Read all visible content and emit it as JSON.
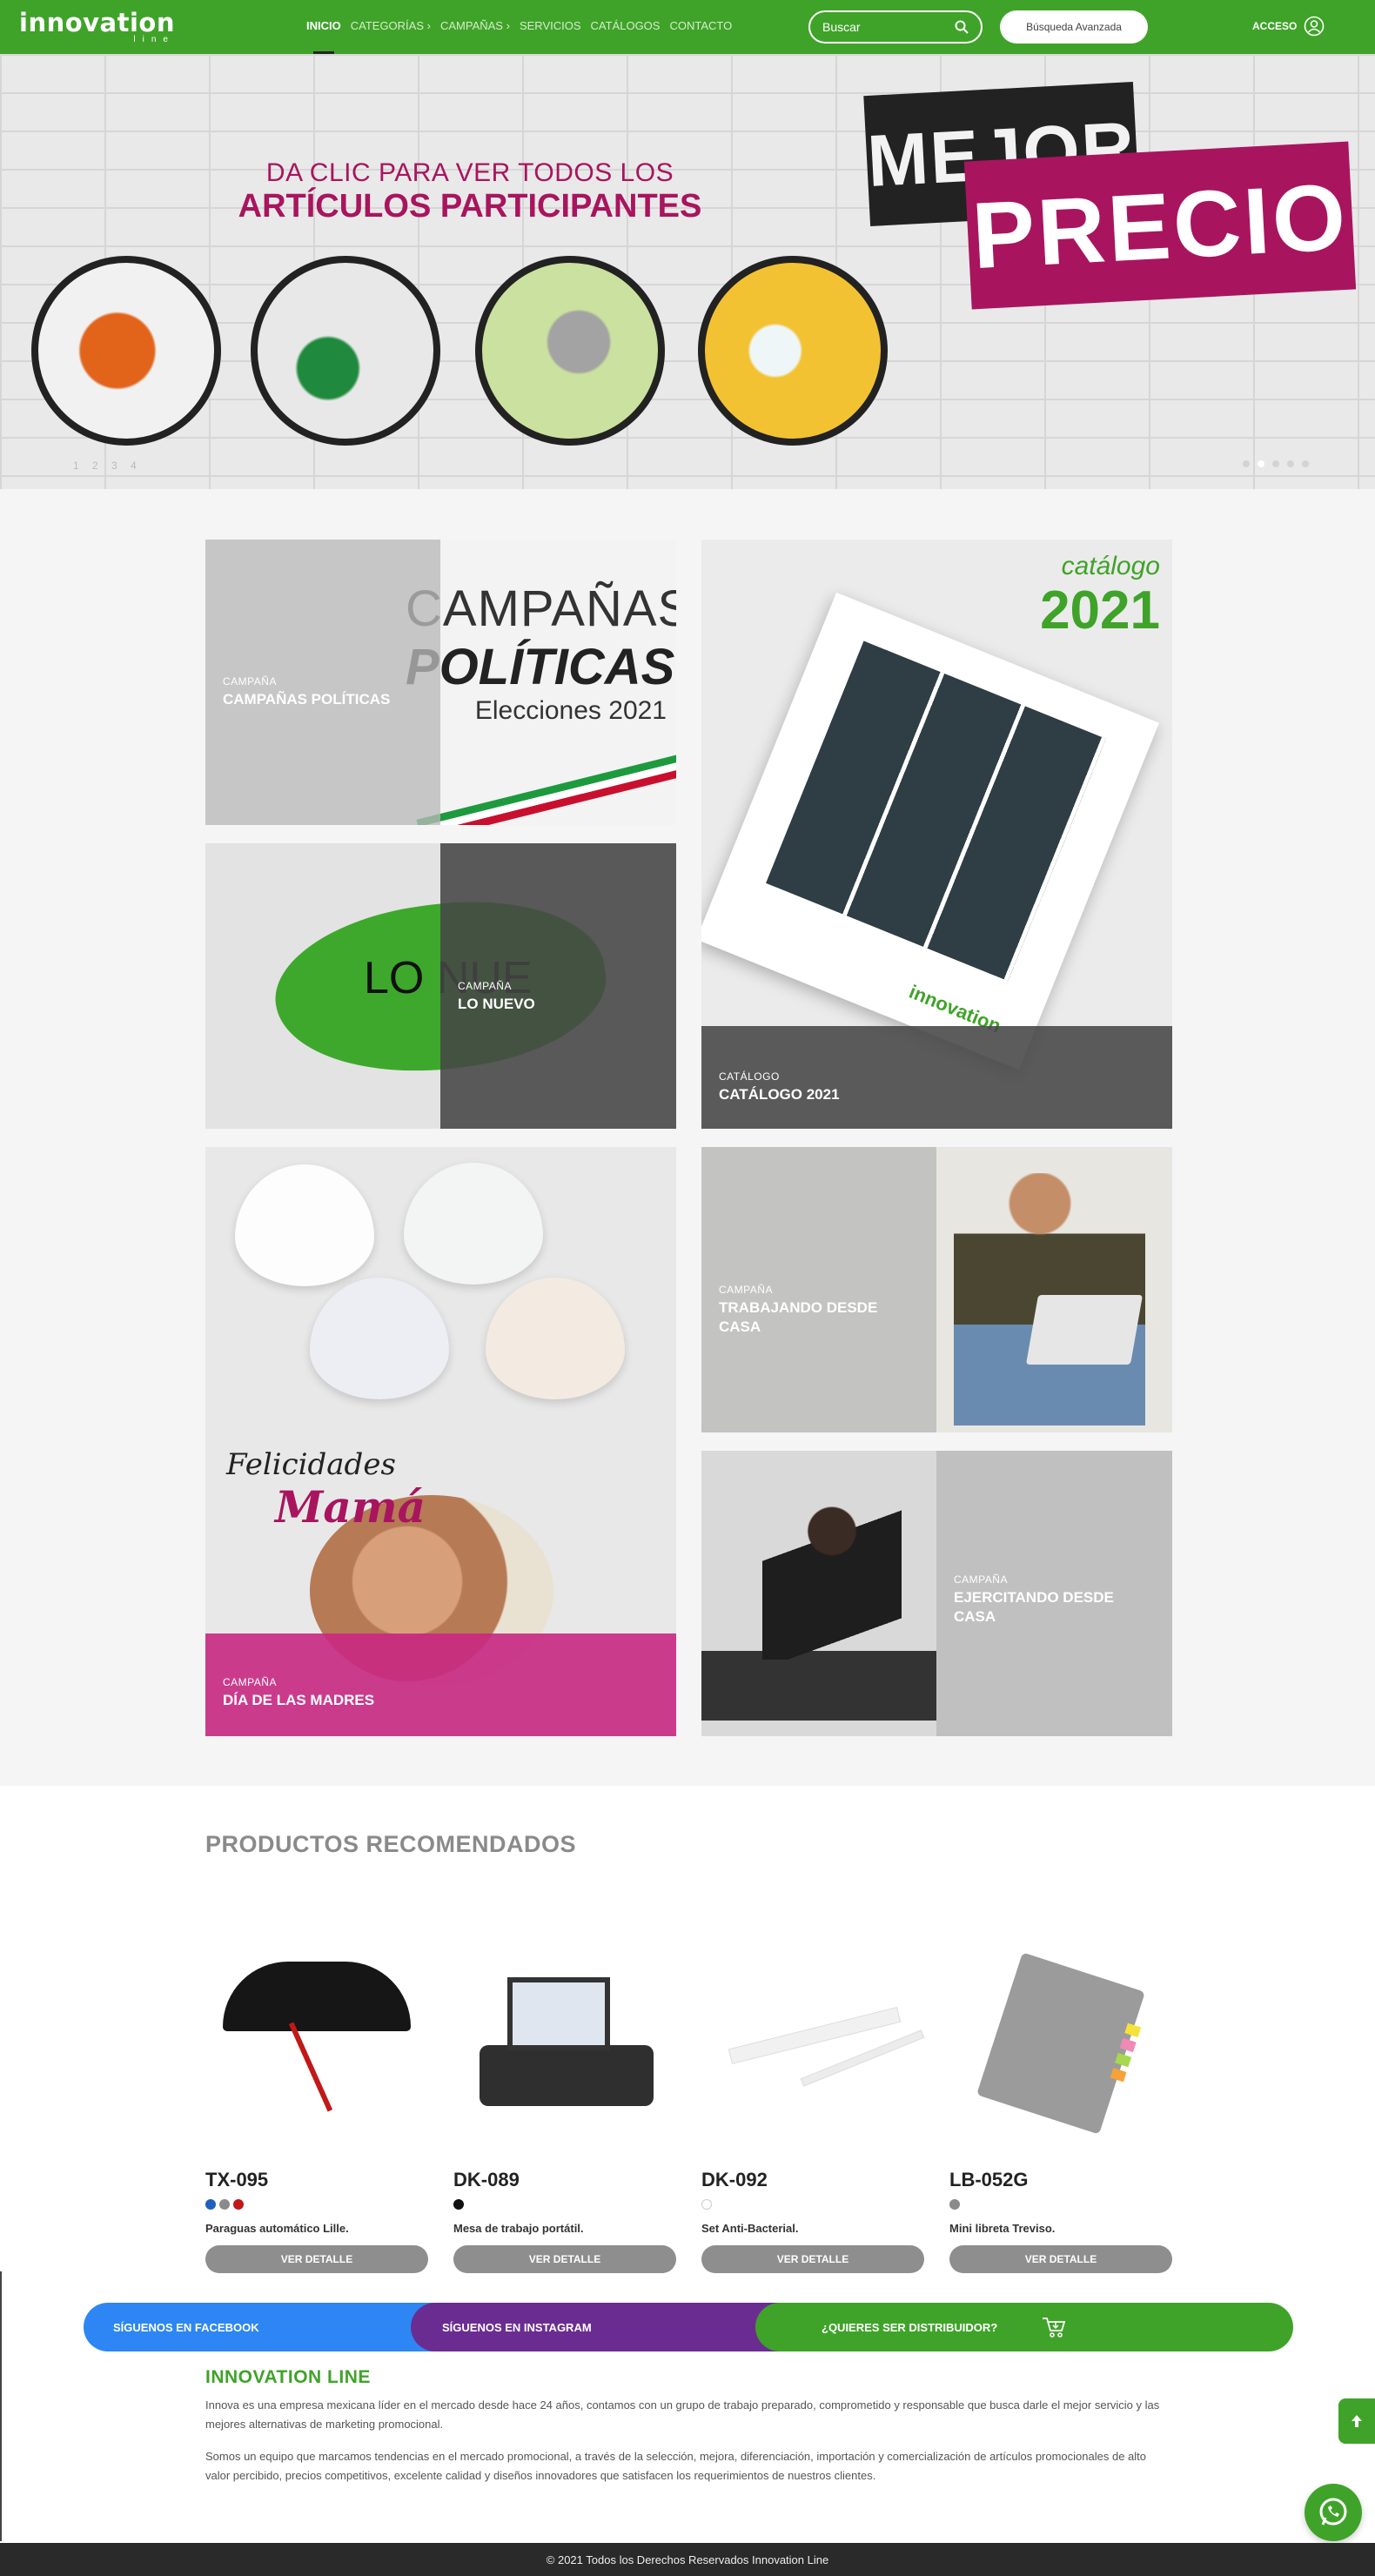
{
  "nav": {
    "logo": "innovation",
    "logo_sub": "line",
    "menu": [
      "INICIO",
      "CATEGORÍAS",
      "CAMPAÑAS",
      "SERVICIOS",
      "CATÁLOGOS",
      "CONTACTO"
    ],
    "search_placeholder": "Buscar",
    "advanced_search": "Búsqueda Avanzada",
    "login": "ACCESO"
  },
  "hero": {
    "line1": "DA CLIC PARA VER TODOS LOS",
    "line2": "ARTÍCULOS PARTICIPANTES",
    "badge1": "MEJOR",
    "badge2": "PRECIO",
    "slide_numbers": "1 2 3 4"
  },
  "campaigns": [
    {
      "kicker": "CAMPAÑA",
      "title": "CAMPAÑAS POLÍTICAS",
      "art1": "CAMPAÑAS",
      "art2": "POLÍTICAS",
      "art3": "Elecciones 2021"
    },
    {
      "kicker": "CAMPAÑA",
      "title": "LO NUEVO",
      "art": "LO NUE"
    },
    {
      "kicker": "CATÁLOGO",
      "title": "CATÁLOGO 2021",
      "art_word": "catálogo",
      "art_year": "2021",
      "book_logo": "innovation"
    },
    {
      "kicker": "CAMPAÑA",
      "title": "DÍA DE LAS MADRES",
      "art1": "Felicidades",
      "art2": "Mamá"
    },
    {
      "kicker": "CAMPAÑA",
      "title": "TRABAJANDO DESDE CASA"
    },
    {
      "kicker": "CAMPAÑA",
      "title": "EJERCITANDO DESDE CASA"
    }
  ],
  "products_title": "PRODUCTOS RECOMENDADOS",
  "products": [
    {
      "code": "TX-095",
      "desc": "Paraguas automático Lille.",
      "button": "VER DETALLE",
      "colors": [
        "#1f5fbf",
        "#8a8a8a",
        "#c21818"
      ]
    },
    {
      "code": "DK-089",
      "desc": "Mesa de trabajo portátil.",
      "button": "VER DETALLE",
      "colors": [
        "#111111"
      ]
    },
    {
      "code": "DK-092",
      "desc": "Set Anti-Bacterial.",
      "button": "VER DETALLE",
      "colors": [
        "#ffffff"
      ]
    },
    {
      "code": "LB-052G",
      "desc": "Mini libreta Treviso.",
      "button": "VER DETALLE",
      "colors": [
        "#8a8a8a"
      ]
    }
  ],
  "social": {
    "facebook": "SÍGUENOS EN FACEBOOK",
    "instagram": "SÍGUENOS EN INSTAGRAM",
    "distributor": "¿QUIERES SER DISTRIBUIDOR?"
  },
  "about": {
    "title": "INNOVATION LINE",
    "p1": "Innova es una empresa mexicana líder en el mercado desde hace 24 años, contamos con un grupo de trabajo preparado, comprometido y responsable que busca darle el mejor servicio y las mejores alternativas de marketing promocional.",
    "p2": "Somos un equipo que marcamos tendencias en el mercado promocional, a través de la selección, mejora, diferenciación, importación y comercialización de artículos promocionales de alto valor percibido, precios competitivos, excelente calidad y diseños innovadores que satisfacen los requerimientos de nuestros clientes."
  },
  "footer": "© 2021 Todos los Derechos Reservados Innovation Line",
  "colors": {
    "brand_green": "#3fa329",
    "accent_pink": "#a8155e",
    "facebook_blue": "#2d86f3",
    "instagram_purple": "#6b2c92"
  }
}
